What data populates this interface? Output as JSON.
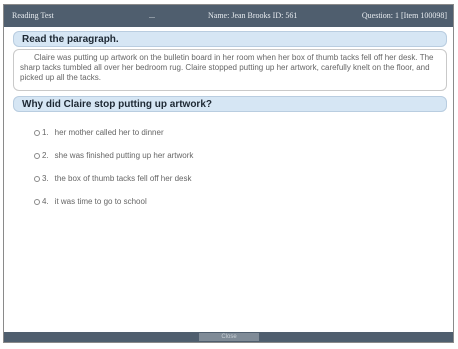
{
  "header": {
    "title": "Reading Test",
    "dots": "...",
    "name": "Name: Jean Brooks ID: 561",
    "question": "Question: 1 [Item 100098]"
  },
  "instruction": "Read the paragraph.",
  "passage": "Claire was putting up artwork on the bulletin board in her room when her box of thumb tacks fell off her desk. The sharp tacks tumbled all over her bedroom rug. Claire stopped putting up her artwork, carefully knelt on the floor, and picked up all the tacks.",
  "question_text": "Why did Claire stop putting up artwork?",
  "options": [
    {
      "num": "1.",
      "text": "her mother called her to dinner"
    },
    {
      "num": "2.",
      "text": "she was finished putting up her artwork"
    },
    {
      "num": "3.",
      "text": "the box of thumb tacks fell off her desk"
    },
    {
      "num": "4.",
      "text": "it was time to go to school"
    }
  ],
  "footer": {
    "button_label": "Close"
  },
  "colors": {
    "header_bg": "#4f5e6e",
    "section_bg": "#d6e6f4"
  }
}
